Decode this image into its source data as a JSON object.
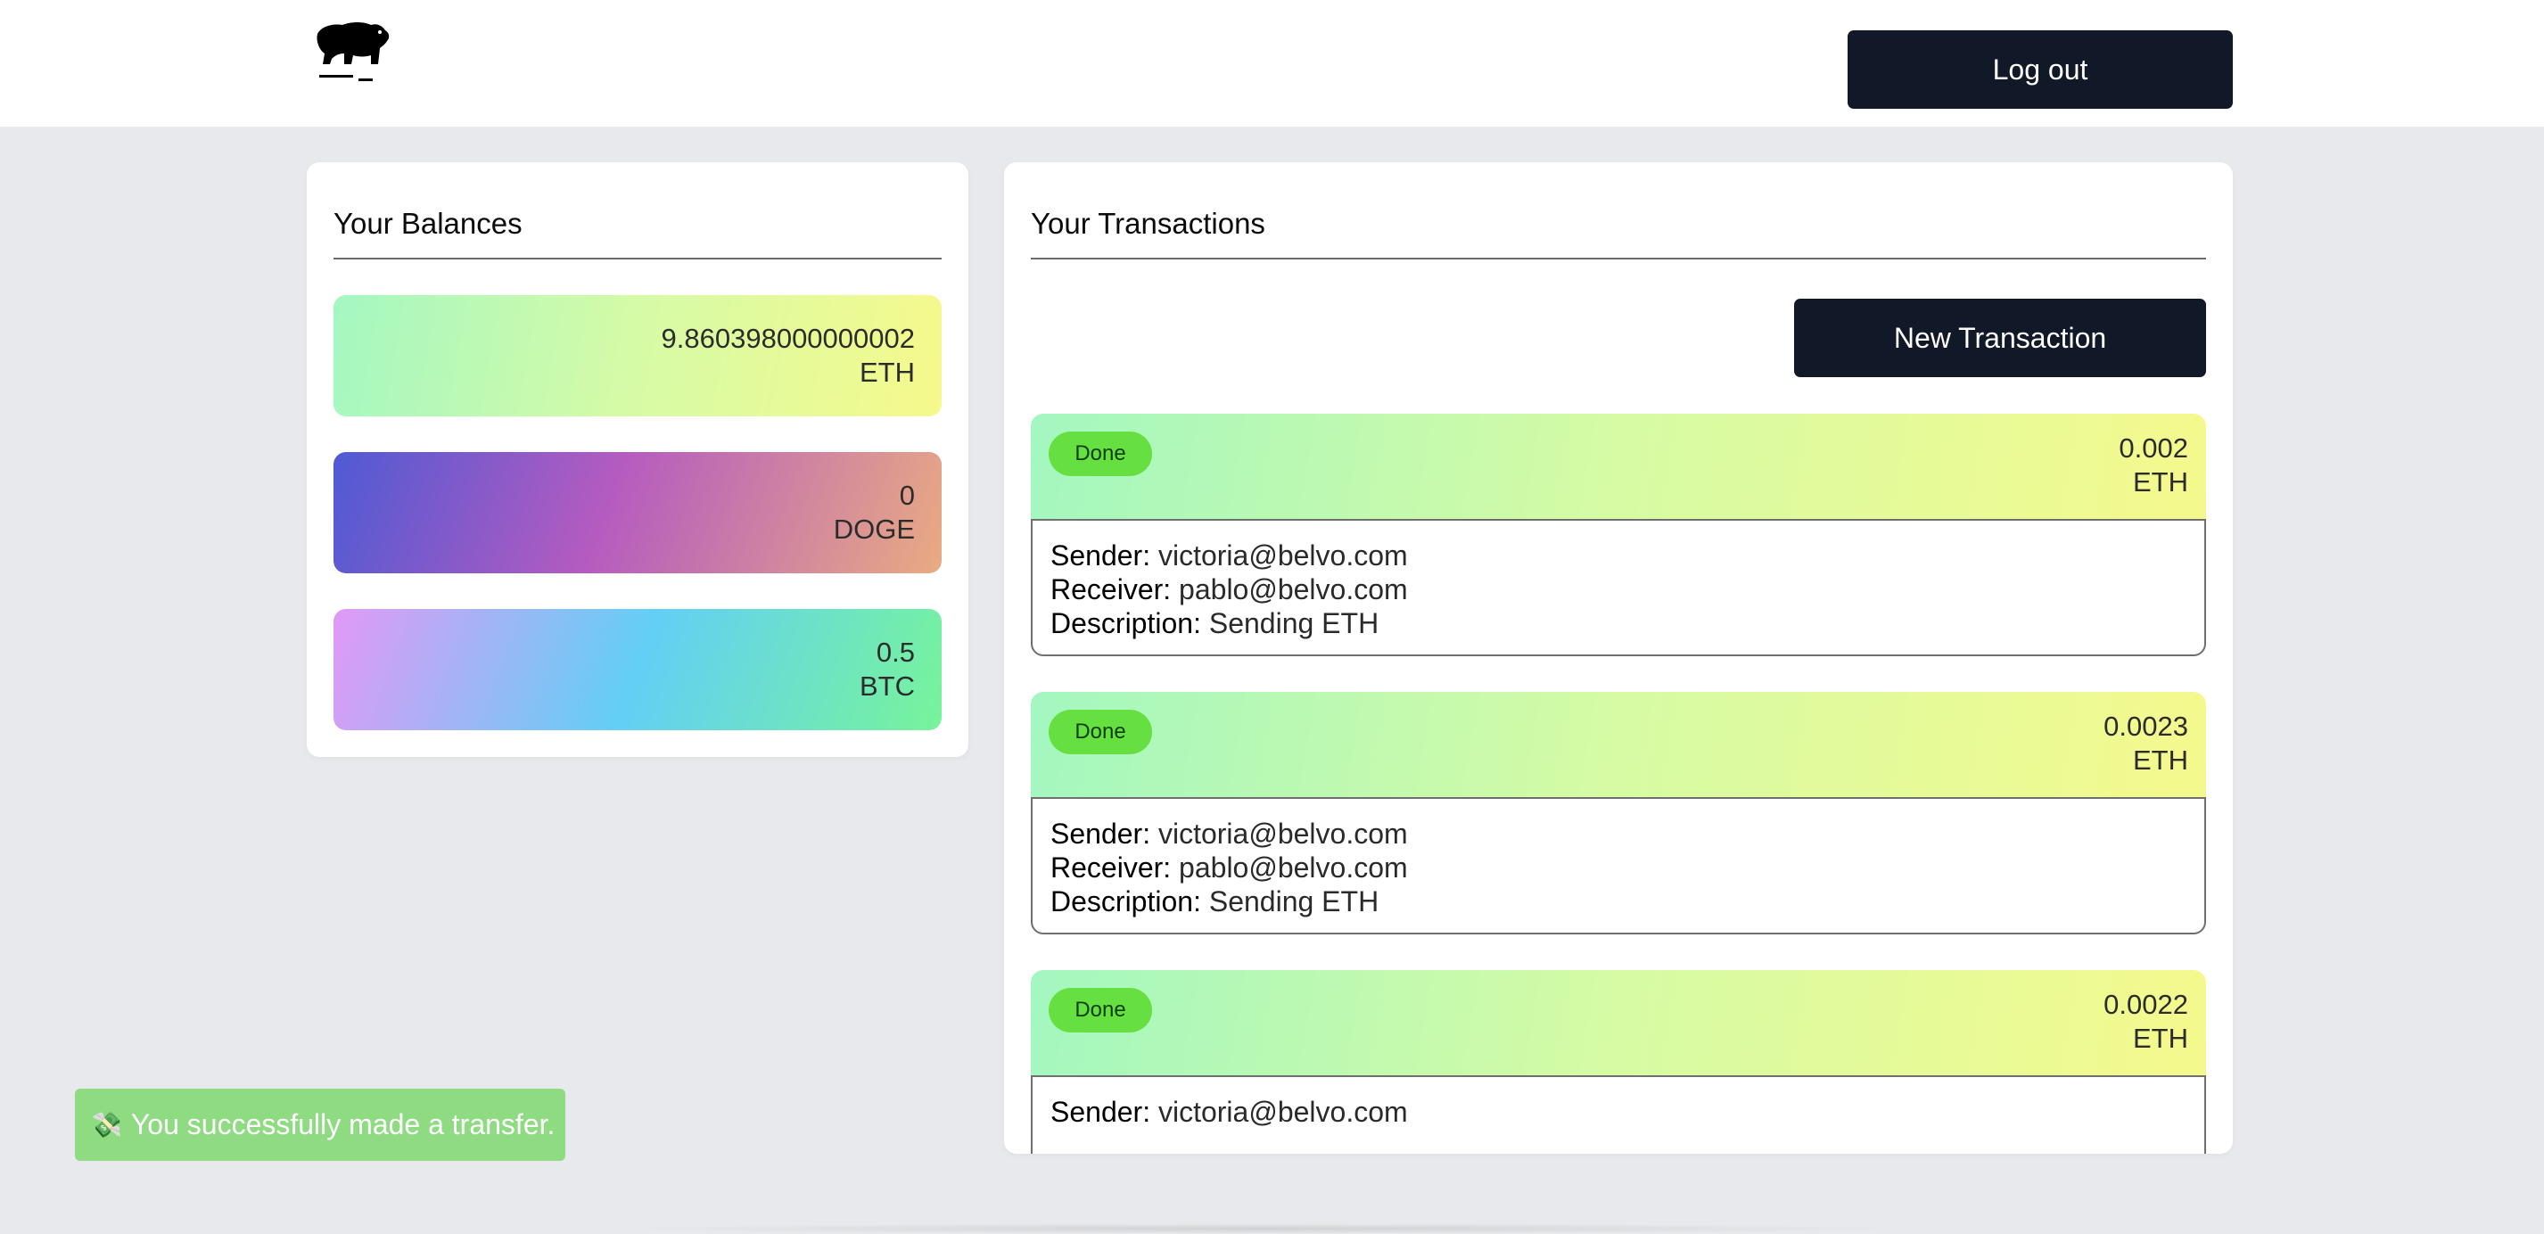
{
  "header": {
    "logo_icon": "bear-logo-icon",
    "logout_label": "Log out"
  },
  "balances": {
    "title": "Your Balances",
    "items": [
      {
        "amount": "9.860398000000002",
        "currency": "ETH"
      },
      {
        "amount": "0",
        "currency": "DOGE"
      },
      {
        "amount": "0.5",
        "currency": "BTC"
      }
    ]
  },
  "transactions": {
    "title": "Your Transactions",
    "new_label": "New Transaction",
    "labels": {
      "sender": "Sender:",
      "receiver": "Receiver:",
      "description": "Description:"
    },
    "items": [
      {
        "status": "Done",
        "amount": "0.002",
        "currency": "ETH",
        "sender": "victoria@belvo.com",
        "receiver": "pablo@belvo.com",
        "description": "Sending ETH"
      },
      {
        "status": "Done",
        "amount": "0.0023",
        "currency": "ETH",
        "sender": "victoria@belvo.com",
        "receiver": "pablo@belvo.com",
        "description": "Sending ETH"
      },
      {
        "status": "Done",
        "amount": "0.0022",
        "currency": "ETH",
        "sender": "victoria@belvo.com"
      }
    ]
  },
  "toast": {
    "icon": "money-wings-icon",
    "glyph": "💸",
    "message": "You successfully made a transfer."
  },
  "colors": {
    "dark_button": "#111827",
    "done_badge": "#66e041",
    "toast": "#8fdb82",
    "background": "#e8e9ec"
  }
}
